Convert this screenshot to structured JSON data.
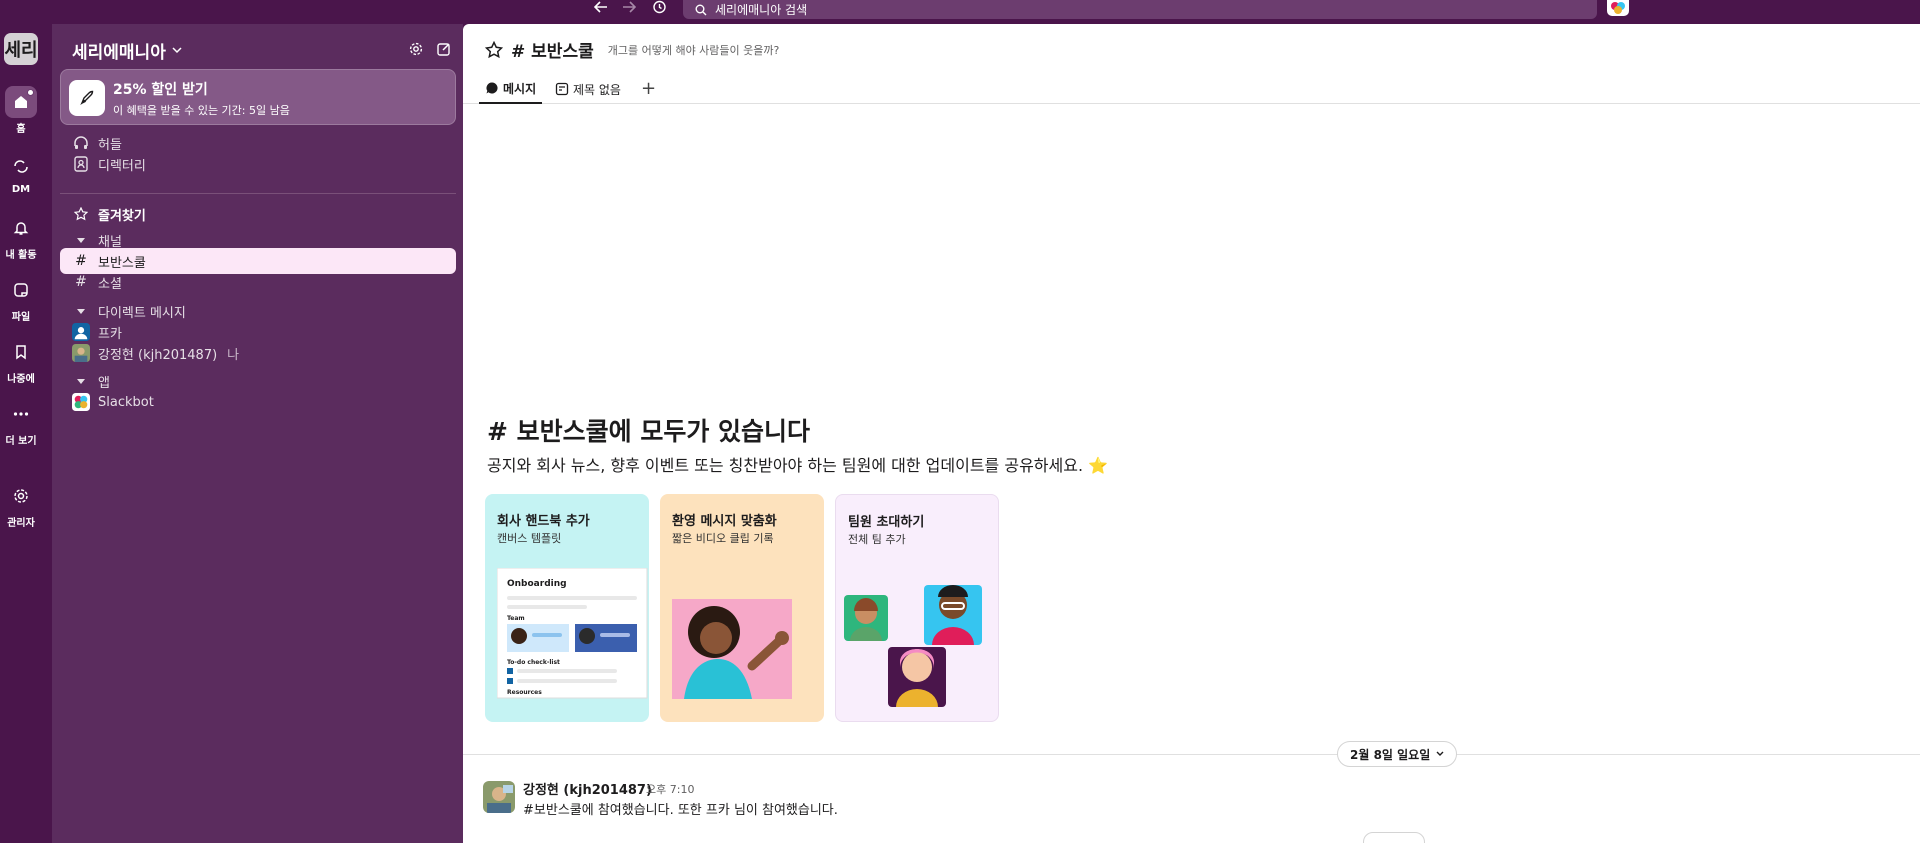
{
  "topbar": {
    "search_placeholder": "세리에매니아 검색"
  },
  "rail": {
    "workspace_logo": "세리",
    "items": [
      {
        "label": "홈",
        "icon": "home-icon"
      },
      {
        "label": "DM",
        "icon": "dm-icon"
      },
      {
        "label": "내 활동",
        "icon": "bell-icon"
      },
      {
        "label": "파일",
        "icon": "files-icon"
      },
      {
        "label": "나중에",
        "icon": "bookmark-icon"
      },
      {
        "label": "더 보기",
        "icon": "more-icon"
      },
      {
        "label": "관리자",
        "icon": "gear-icon"
      }
    ]
  },
  "sidebar": {
    "workspace_name": "세리에매니아",
    "promo": {
      "title": "25% 할인 받기",
      "subtitle": "이 혜택을 받을 수 있는 기간: 5일 남음"
    },
    "top_items": [
      {
        "label": "허들",
        "icon": "headphones-icon"
      },
      {
        "label": "디렉터리",
        "icon": "directory-icon"
      }
    ],
    "favorites_label": "즐겨찾기",
    "channels_section": "채널",
    "channels": [
      "보반스쿨",
      "소셜"
    ],
    "dm_section": "다이렉트 메시지",
    "dms": [
      {
        "name": "프카",
        "suffix": ""
      },
      {
        "name": "강정현 (kjh201487)",
        "suffix": "나"
      }
    ],
    "apps_section": "앱",
    "apps": [
      "Slackbot"
    ]
  },
  "channel": {
    "name": "# 보반스쿨",
    "topic": "개그를 어떻게 해야 사람들이 웃을까?",
    "tabs": [
      {
        "label": "메시지",
        "icon": "message-icon"
      },
      {
        "label": "제목 없음",
        "icon": "canvas-icon"
      }
    ],
    "add_tab": "+",
    "intro_title": "# 보반스쿨에 모두가 있습니다",
    "intro_desc": "공지와 회사 뉴스, 향후 이벤트 또는 칭찬받아야 하는 팀원에 대한 업데이트를 공유하세요. ⭐",
    "cards": [
      {
        "title": "회사 핸드북 추가",
        "subtitle": "캔버스 템플릿",
        "bg": "#c5f3f3"
      },
      {
        "title": "환영 메시지 맞춤화",
        "subtitle": "짧은 비디오 클립 기록",
        "bg": "#fde2bd"
      },
      {
        "title": "팀원 초대하기",
        "subtitle": "전체 팀 추가",
        "bg": "#f9eefc"
      }
    ],
    "card_preview": {
      "heading": "Onboarding",
      "team": "Team",
      "todo": "To-do check-list",
      "resources": "Resources"
    },
    "date_divider": "2월 8일 일요일",
    "message": {
      "author": "강정현 (kjh201487)",
      "time": "오후 7:10",
      "text": "#보반스쿨에 참여했습니다. 또한 프카 님이 참여했습니다."
    }
  },
  "colors": {
    "aubergine": "#4a154b",
    "sidebar": "#5b2c5e",
    "active_row": "#fce7f7"
  }
}
